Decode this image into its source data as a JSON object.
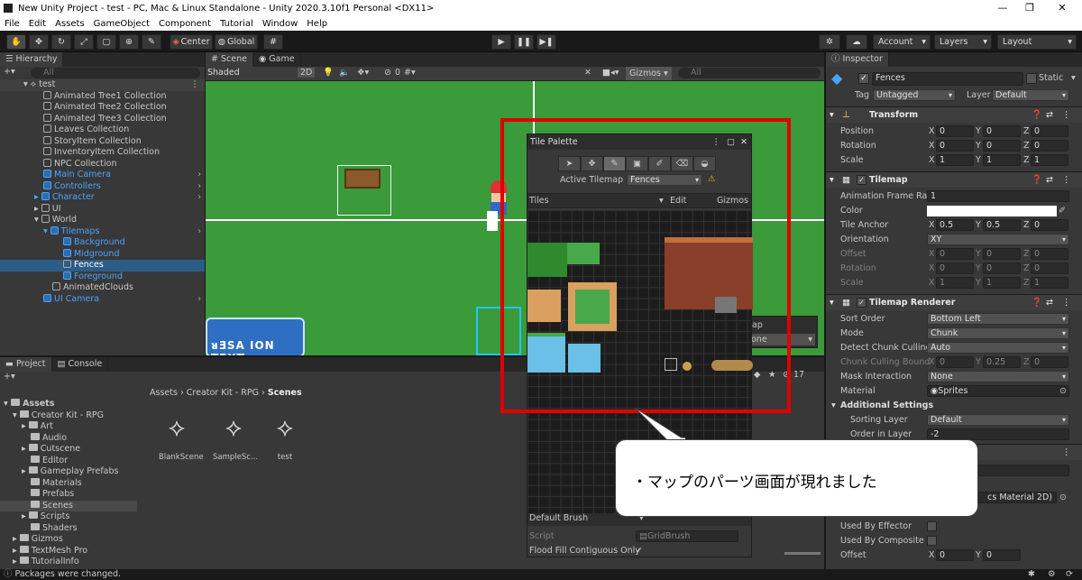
{
  "window": {
    "title": "New Unity Project - test - PC, Mac & Linux Standalone - Unity 2020.3.10f1 Personal <DX11>",
    "min": "—",
    "max": "❐",
    "close": "✕"
  },
  "menu": [
    "File",
    "Edit",
    "Assets",
    "GameObject",
    "Component",
    "Tutorial",
    "Window",
    "Help"
  ],
  "toolbar": {
    "center": "Center",
    "global": "Global",
    "account": "Account",
    "layers": "Layers",
    "layout": "Layout"
  },
  "hierarchy": {
    "tab": "Hierarchy",
    "search_placeholder": "All",
    "scene": "test",
    "items": [
      "Animated Tree1 Collection",
      "Animated Tree2 Collection",
      "Animated Tree3 Collection",
      "Leaves Collection",
      "StoryItem Collection",
      "InventoryItem Collection",
      "NPC Collection",
      "Main Camera",
      "Controllers",
      "Character",
      "UI",
      "World",
      "Tilemaps",
      "Background",
      "Midground",
      "Fences",
      "Foreground",
      "AnimatedClouds",
      "UI Camera"
    ]
  },
  "scene_view": {
    "tab_scene": "Scene",
    "tab_game": "Game",
    "shading": "Shaded",
    "mode_2d": "2D",
    "hidden_count": "0",
    "gizmos": "Gizmos",
    "search_placeholder": "All",
    "ui_text": "ᴚƎSA ION TEXT"
  },
  "project": {
    "tab_project": "Project",
    "tab_console": "Console",
    "breadcrumb": [
      "Assets",
      "Creator Kit - RPG",
      "Scenes"
    ],
    "hidden_count": "17",
    "tree": [
      "Assets",
      "Creator Kit - RPG",
      "Art",
      "Audio",
      "Cutscene",
      "Editor",
      "Gameplay Prefabs",
      "Materials",
      "Prefabs",
      "Scenes",
      "Scripts",
      "Shaders",
      "Gizmos",
      "TextMesh Pro",
      "TutorialInfo"
    ],
    "assets": [
      "BlankScene",
      "SampleSc...",
      "test"
    ]
  },
  "tile_palette": {
    "title": "Tile Palette",
    "active_tilemap_label": "Active Tilemap",
    "active_tilemap": "Fences",
    "palette": "Tiles",
    "edit": "Edit",
    "gizmos": "Gizmos",
    "brush": "Default Brush",
    "script_label": "Script",
    "script_value": "GridBrush",
    "flood_fill": "Flood Fill Contiguous Only",
    "behind_text1": "ap",
    "behind_text2": "one"
  },
  "inspector": {
    "tab": "Inspector",
    "object_name": "Fences",
    "static": "Static",
    "tag_label": "Tag",
    "tag": "Untagged",
    "layer_label": "Layer",
    "layer": "Default",
    "transform": {
      "title": "Transform",
      "position": [
        "0",
        "0",
        "0"
      ],
      "rotation": [
        "0",
        "0",
        "0"
      ],
      "scale": [
        "1",
        "1",
        "1"
      ],
      "position_label": "Position",
      "rotation_label": "Rotation",
      "scale_label": "Scale"
    },
    "tilemap": {
      "title": "Tilemap",
      "anim_rate_label": "Animation Frame Rate",
      "anim_rate": "1",
      "color_label": "Color",
      "anchor_label": "Tile Anchor",
      "anchor": [
        "0.5",
        "0.5",
        "0"
      ],
      "orientation_label": "Orientation",
      "orientation": "XY",
      "offset_label": "Offset",
      "offset": [
        "0",
        "0",
        "0"
      ],
      "rotation_label": "Rotation",
      "rotation": [
        "0",
        "0",
        "0"
      ],
      "scale_label": "Scale",
      "scale": [
        "1",
        "1",
        "1"
      ]
    },
    "renderer": {
      "title": "Tilemap Renderer",
      "sort_order_label": "Sort Order",
      "sort_order": "Bottom Left",
      "mode_label": "Mode",
      "mode": "Chunk",
      "culling_label": "Detect Chunk Culling",
      "culling": "Auto",
      "bounds_label": "Chunk Culling Bound",
      "bounds": [
        "0",
        "0.25",
        "0"
      ],
      "mask_label": "Mask Interaction",
      "mask": "None",
      "material_label": "Material",
      "material": "Sprites",
      "additional": "Additional Settings",
      "sorting_layer_label": "Sorting Layer",
      "sorting_layer": "Default",
      "order_label": "Order in Layer",
      "order": "-2"
    },
    "collider": {
      "material_fragment": "cs Material 2D)",
      "effector_label": "Used By Effector",
      "composite_label": "Used By Composite",
      "offset_label": "Offset",
      "offset": [
        "0",
        "0"
      ]
    }
  },
  "callout": {
    "text": "・マップのパーツ画面が現れました"
  },
  "status": "Packages were changed."
}
